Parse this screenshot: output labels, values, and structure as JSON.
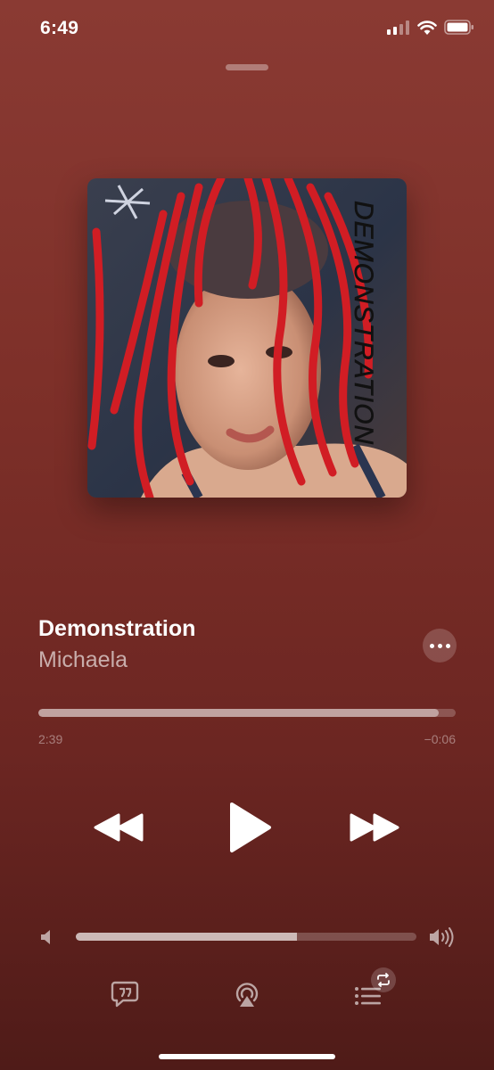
{
  "status_bar": {
    "time": "6:49",
    "icons": [
      "cellular-signal-icon",
      "wifi-icon",
      "battery-icon"
    ]
  },
  "now_playing": {
    "artwork_text": "DEMONSTRATION",
    "title": "Demonstration",
    "artist": "Michaela",
    "elapsed": "2:39",
    "remaining": "−0:06",
    "progress_fraction": 0.96,
    "volume_fraction": 0.65
  },
  "controls": {
    "icons": [
      "rewind-icon",
      "play-icon",
      "fast-forward-icon"
    ]
  },
  "bottom_bar": {
    "icons": [
      "lyrics-icon",
      "airplay-icon",
      "queue-icon",
      "repeat-icon"
    ]
  },
  "colors": {
    "background_top": "#8a3a33",
    "background_bottom": "#4f1b18",
    "foreground": "#ffffff"
  }
}
